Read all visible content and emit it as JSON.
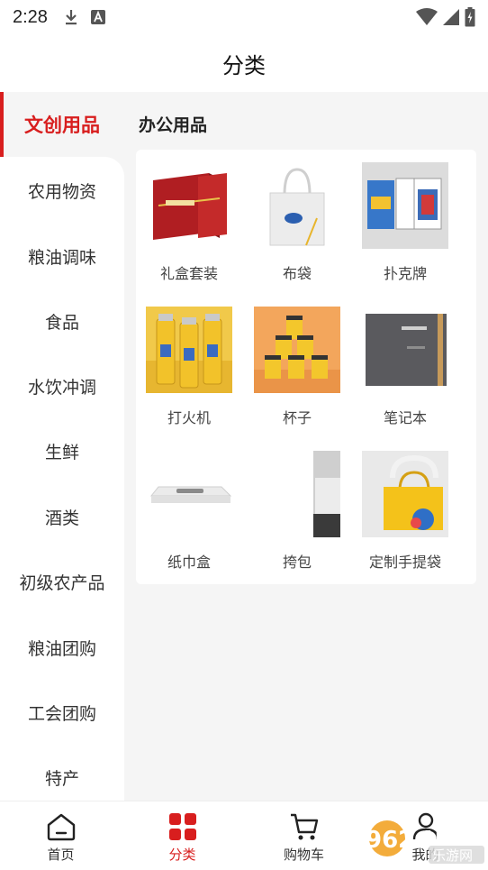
{
  "status_bar": {
    "time": "2:28"
  },
  "header": {
    "title": "分类"
  },
  "sidebar": {
    "items": [
      {
        "label": "文创用品",
        "active": true
      },
      {
        "label": "农用物资"
      },
      {
        "label": "粮油调味"
      },
      {
        "label": "食品"
      },
      {
        "label": "水饮冲调"
      },
      {
        "label": "生鲜"
      },
      {
        "label": "酒类"
      },
      {
        "label": "初级农产品"
      },
      {
        "label": "粮油团购"
      },
      {
        "label": "工会团购"
      },
      {
        "label": "特产"
      }
    ]
  },
  "content": {
    "section_title": "办公用品",
    "products": [
      {
        "label": "礼盒套装",
        "icon": "gift-box-image"
      },
      {
        "label": "布袋",
        "icon": "tote-bag-image"
      },
      {
        "label": "扑克牌",
        "icon": "playing-cards-image"
      },
      {
        "label": "打火机",
        "icon": "lighter-image"
      },
      {
        "label": "杯子",
        "icon": "cups-image"
      },
      {
        "label": "笔记本",
        "icon": "notebook-image"
      },
      {
        "label": "纸巾盒",
        "icon": "tissue-box-image"
      },
      {
        "label": "挎包",
        "icon": "shoulder-bag-image"
      },
      {
        "label": "定制手提袋",
        "icon": "handbag-image"
      }
    ]
  },
  "bottom_nav": {
    "items": [
      {
        "label": "首页",
        "icon": "home-icon"
      },
      {
        "label": "分类",
        "icon": "category-icon",
        "active": true
      },
      {
        "label": "购物车",
        "icon": "cart-icon"
      },
      {
        "label": "我的",
        "icon": "user-icon"
      }
    ]
  },
  "colors": {
    "accent": "#d81e1e",
    "background": "#f5f5f5"
  },
  "watermark": {
    "text_main": "962.NET",
    "text_sub": "乐游网"
  }
}
